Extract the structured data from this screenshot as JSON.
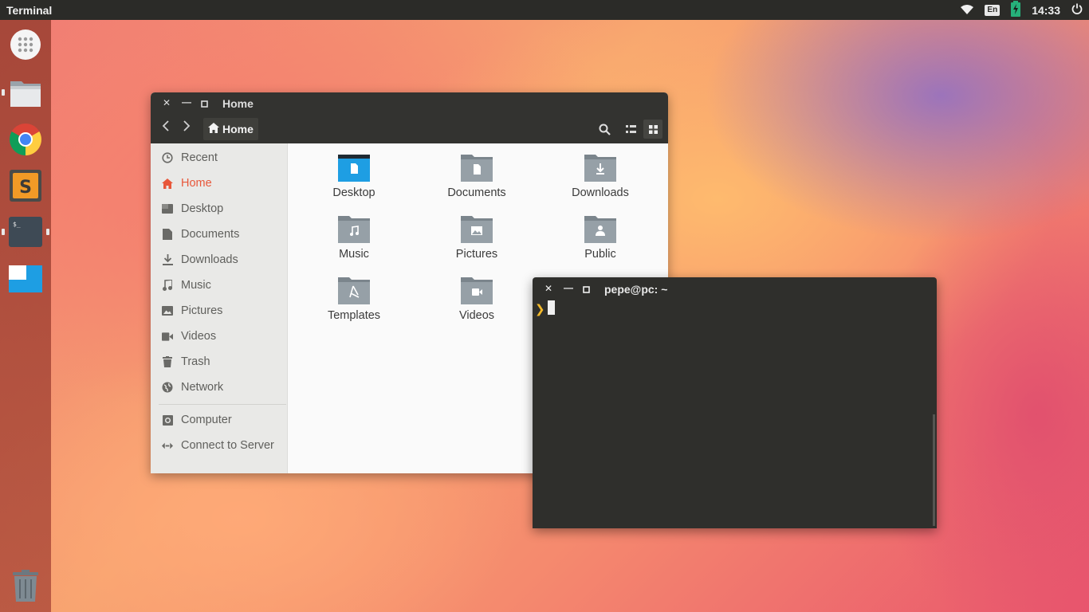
{
  "topbar": {
    "app_name": "Terminal",
    "keyboard_layout": "En",
    "time": "14:33",
    "icons": [
      "wifi-icon",
      "battery-icon",
      "power-icon"
    ]
  },
  "dock": {
    "items": [
      "app-grid",
      "files",
      "chrome",
      "sublime-text",
      "terminal",
      "workspace",
      "trash"
    ],
    "running": [
      "files",
      "terminal"
    ]
  },
  "file_manager": {
    "title": "Home",
    "breadcrumb": "Home",
    "sidebar": [
      {
        "label": "Recent",
        "icon": "clock-icon",
        "active": false
      },
      {
        "label": "Home",
        "icon": "home-icon",
        "active": true
      },
      {
        "label": "Desktop",
        "icon": "desktop-icon",
        "active": false
      },
      {
        "label": "Documents",
        "icon": "document-icon",
        "active": false
      },
      {
        "label": "Downloads",
        "icon": "download-icon",
        "active": false
      },
      {
        "label": "Music",
        "icon": "music-icon",
        "active": false
      },
      {
        "label": "Pictures",
        "icon": "picture-icon",
        "active": false
      },
      {
        "label": "Videos",
        "icon": "video-icon",
        "active": false
      },
      {
        "label": "Trash",
        "icon": "trash-icon",
        "active": false
      },
      {
        "label": "Network",
        "icon": "network-icon",
        "active": false
      },
      {
        "label": "Computer",
        "icon": "computer-icon",
        "active": false
      },
      {
        "label": "Connect to Server",
        "icon": "connect-icon",
        "active": false
      }
    ],
    "files": [
      {
        "label": "Desktop",
        "icon": "folder-desktop-icon"
      },
      {
        "label": "Documents",
        "icon": "folder-documents-icon"
      },
      {
        "label": "Downloads",
        "icon": "folder-downloads-icon"
      },
      {
        "label": "Music",
        "icon": "folder-music-icon"
      },
      {
        "label": "Pictures",
        "icon": "folder-pictures-icon"
      },
      {
        "label": "Public",
        "icon": "folder-public-icon"
      },
      {
        "label": "Templates",
        "icon": "folder-templates-icon"
      },
      {
        "label": "Videos",
        "icon": "folder-videos-icon"
      }
    ]
  },
  "terminal": {
    "title": "pepe@pc: ~",
    "prompt": "❯"
  },
  "colors": {
    "accent": "#e8573a",
    "folder": "#8a9299",
    "desktop_folder": "#1e9ee3",
    "prompt": "#f2b829",
    "titlebar": "#333330"
  }
}
